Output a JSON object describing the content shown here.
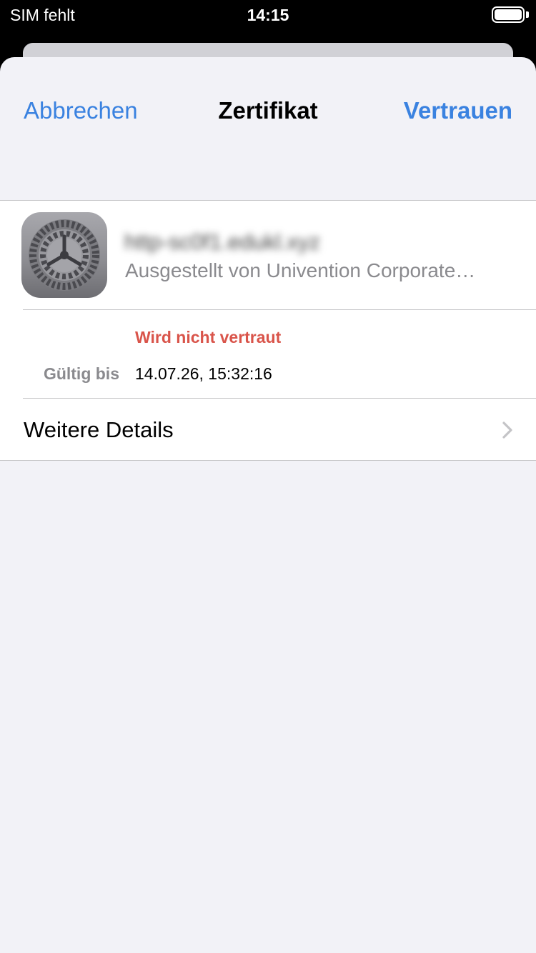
{
  "status_bar": {
    "carrier": "SIM fehlt",
    "time": "14:15"
  },
  "nav": {
    "cancel_label": "Abbrechen",
    "title": "Zertifikat",
    "trust_label": "Vertrauen"
  },
  "certificate": {
    "icon": "settings-gear-icon",
    "name": "http-sc0f1.edukl.xyz",
    "issuer": "Ausgestellt von Univention Corporate…",
    "trust_status": "Wird nicht vertraut",
    "valid_label": "Gültig bis",
    "valid_value": "14.07.26, 15:32:16"
  },
  "details": {
    "label": "Weitere Details",
    "icon": "chevron-right-icon"
  },
  "colors": {
    "accent": "#3a82e0",
    "warning": "#d9544a",
    "secondary_text": "#8a8a8e",
    "background": "#f2f2f7"
  }
}
